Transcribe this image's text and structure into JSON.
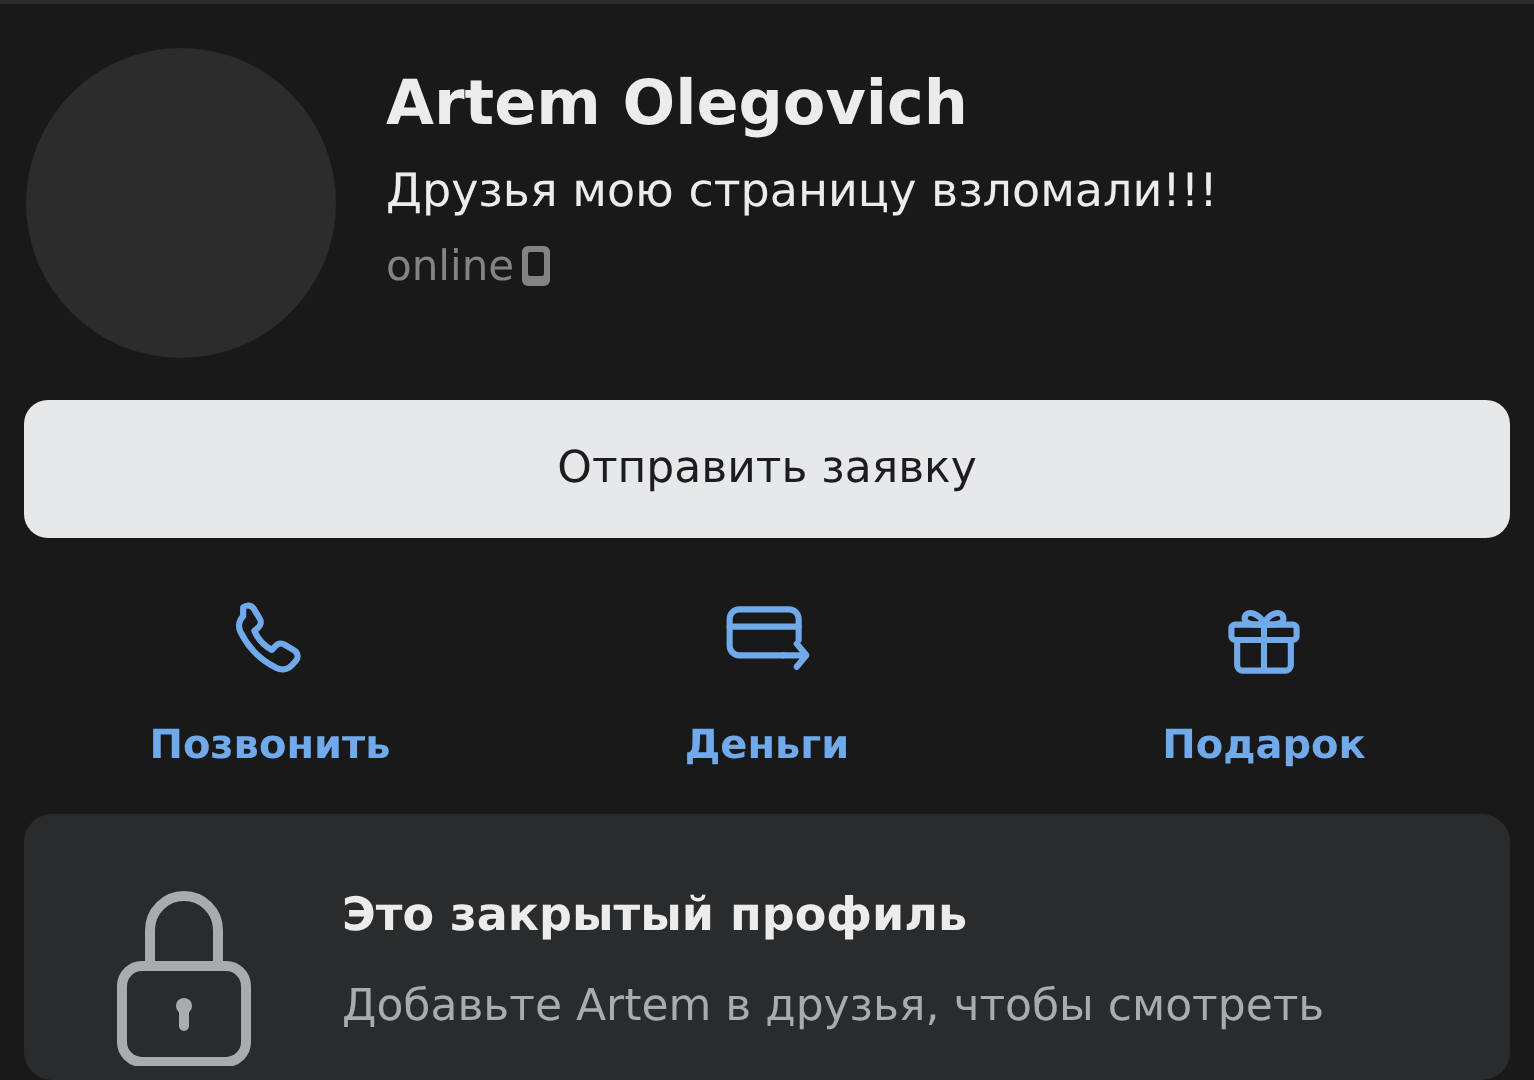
{
  "profile": {
    "name": "Artem Olegovich",
    "status": "Друзья мою страницу взломали!!!",
    "presence": "online",
    "mobile": true
  },
  "primary_button": {
    "label": "Отправить заявку"
  },
  "actions": [
    {
      "kind": "call",
      "label": "Позвонить"
    },
    {
      "kind": "money",
      "label": "Деньги"
    },
    {
      "kind": "gift",
      "label": "Подарок"
    }
  ],
  "private_notice": {
    "title": "Это закрытый профиль",
    "text": "Добавьте Artem в друзья, чтобы смотреть"
  }
}
